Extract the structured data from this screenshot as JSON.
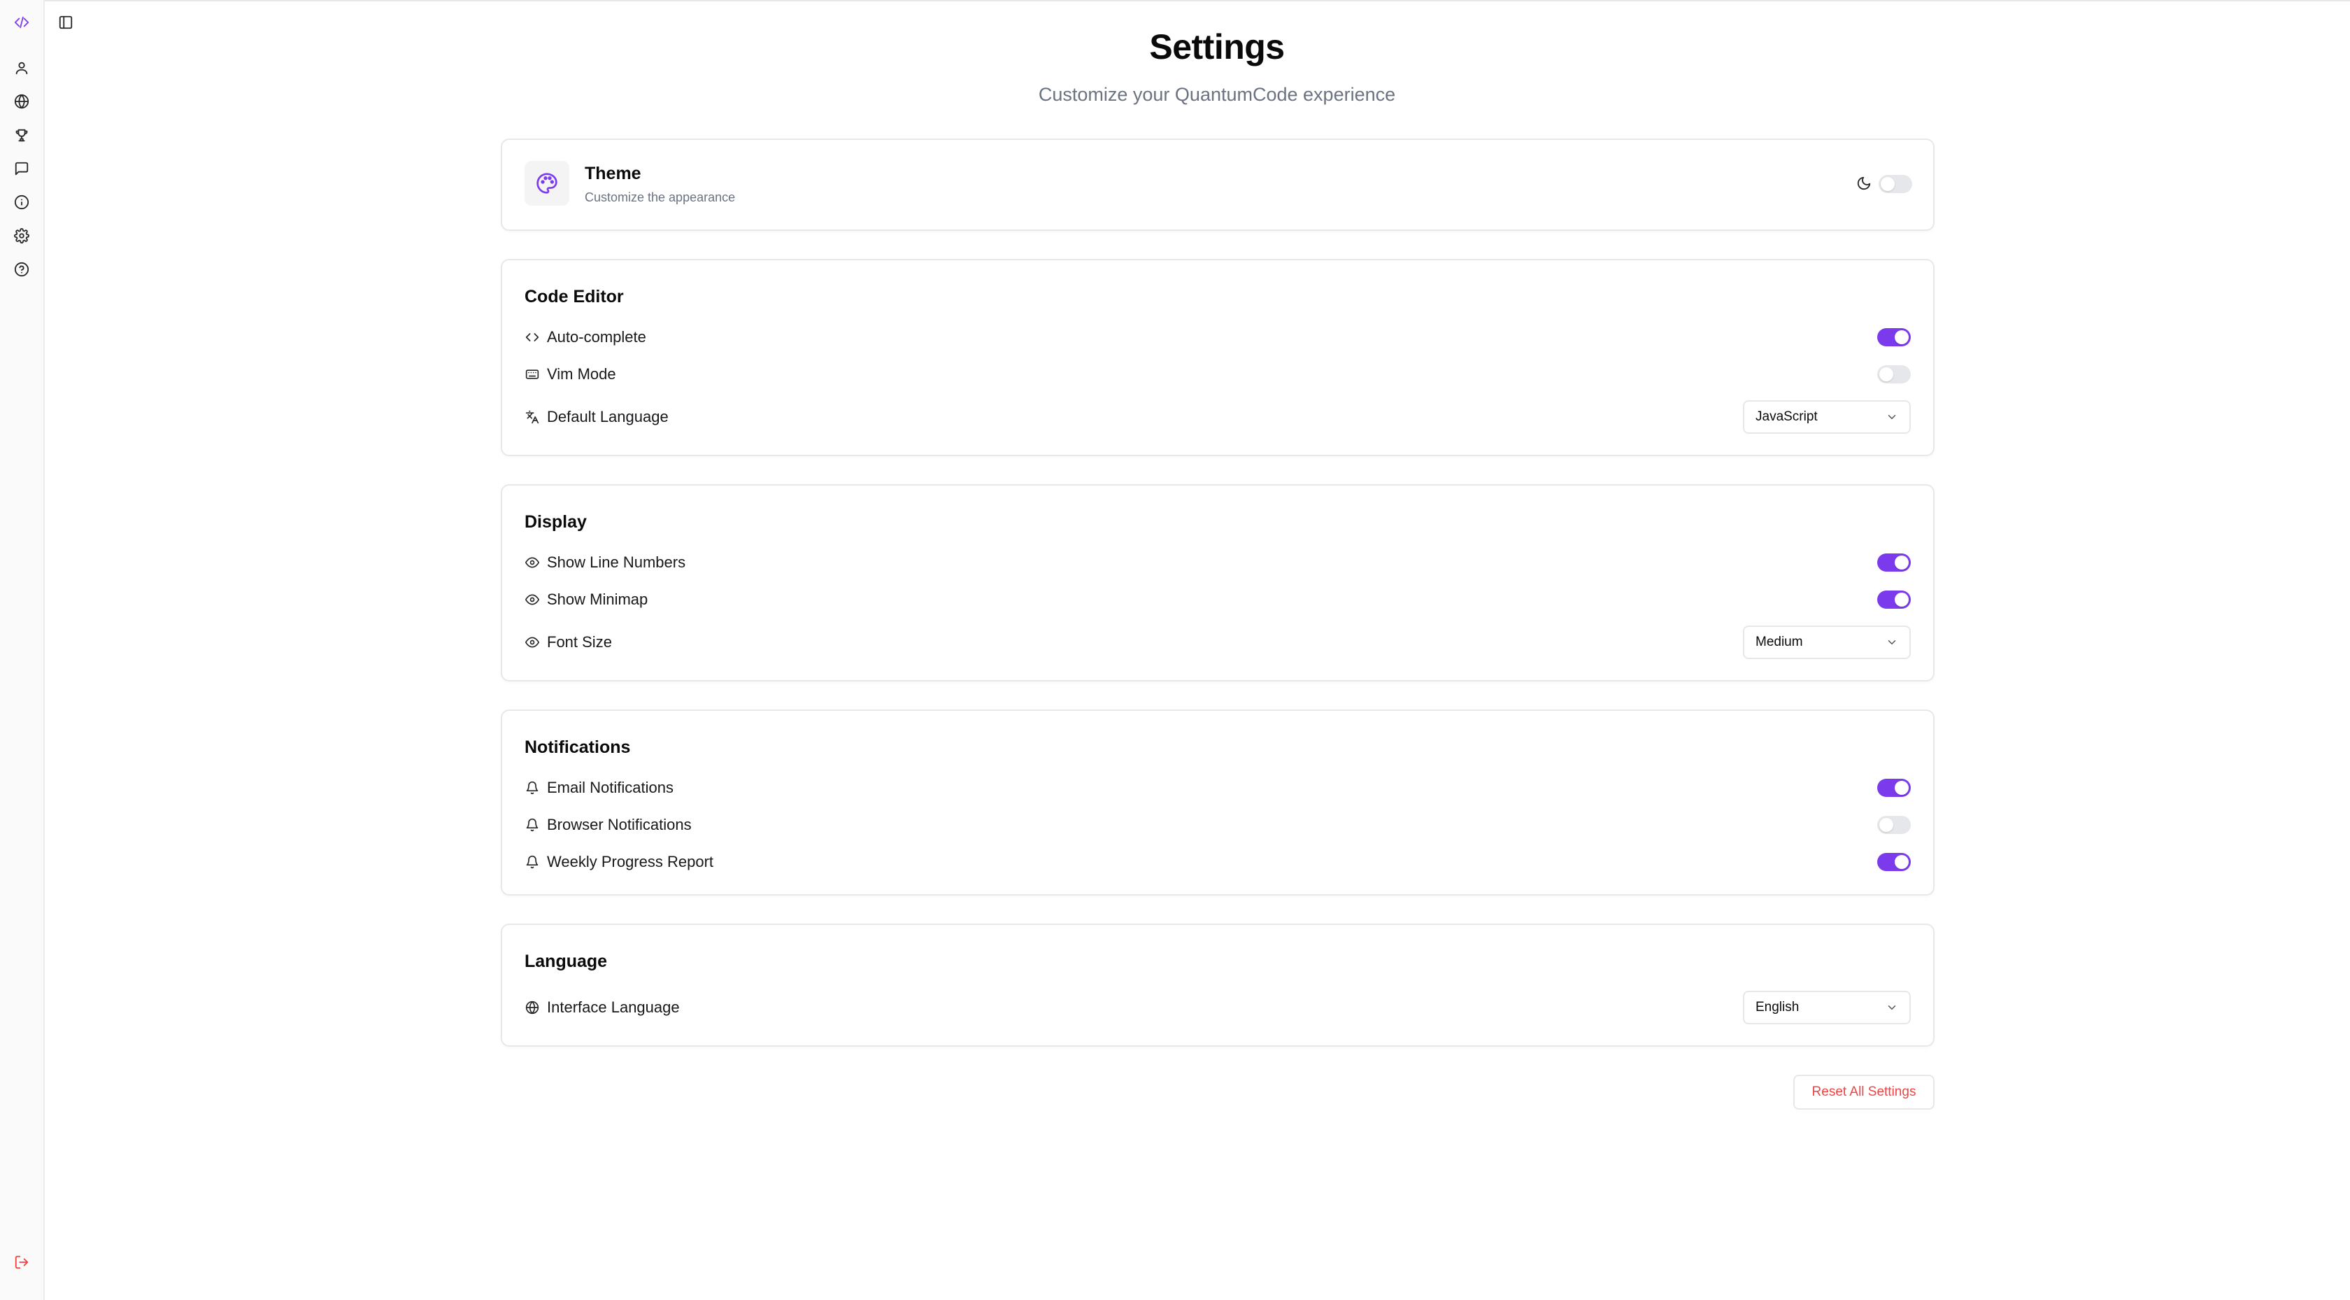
{
  "header": {
    "title": "Settings",
    "subtitle": "Customize your QuantumCode experience"
  },
  "sidebar": {
    "items": [
      {
        "icon": "code-icon",
        "active": true
      },
      {
        "icon": "user-icon"
      },
      {
        "icon": "globe-icon"
      },
      {
        "icon": "trophy-icon"
      },
      {
        "icon": "message-square-icon"
      },
      {
        "icon": "info-icon"
      },
      {
        "icon": "gear-icon"
      },
      {
        "icon": "help-circle-icon"
      }
    ],
    "logout_icon": "logout-icon"
  },
  "theme": {
    "title": "Theme",
    "subtitle": "Customize the appearance",
    "dark_mode": false
  },
  "code_editor": {
    "title": "Code Editor",
    "auto_complete": {
      "label": "Auto-complete",
      "enabled": true
    },
    "vim_mode": {
      "label": "Vim Mode",
      "enabled": false
    },
    "default_language": {
      "label": "Default Language",
      "value": "JavaScript"
    }
  },
  "display": {
    "title": "Display",
    "line_numbers": {
      "label": "Show Line Numbers",
      "enabled": true
    },
    "minimap": {
      "label": "Show Minimap",
      "enabled": true
    },
    "font_size": {
      "label": "Font Size",
      "value": "Medium"
    }
  },
  "notifications": {
    "title": "Notifications",
    "email": {
      "label": "Email Notifications",
      "enabled": true
    },
    "browser": {
      "label": "Browser Notifications",
      "enabled": false
    },
    "weekly": {
      "label": "Weekly Progress Report",
      "enabled": true
    }
  },
  "language": {
    "title": "Language",
    "interface": {
      "label": "Interface Language",
      "value": "English"
    }
  },
  "actions": {
    "reset_label": "Reset All Settings"
  },
  "colors": {
    "accent": "#7c3aed",
    "danger": "#ef4444",
    "muted_text": "#6b7280"
  }
}
